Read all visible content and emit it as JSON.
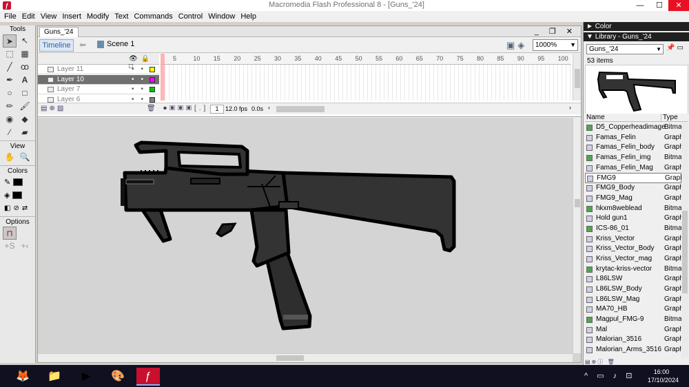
{
  "window": {
    "title": "Macromedia Flash Professional 8 - [Guns_'24]",
    "minimize": "—",
    "maximize": "☐",
    "close": "✕"
  },
  "menu": {
    "items": [
      "File",
      "Edit",
      "View",
      "Insert",
      "Modify",
      "Text",
      "Commands",
      "Control",
      "Window",
      "Help"
    ]
  },
  "tools": {
    "header": "Tools",
    "view_header": "View",
    "colors_header": "Colors",
    "options_header": "Options",
    "stroke_color": "#000000",
    "fill_color": "#000000"
  },
  "document": {
    "tab": "Guns_'24",
    "timeline_button": "Timeline",
    "scene": "Scene 1",
    "zoom": "1000%"
  },
  "timeline": {
    "ticks": [
      "5",
      "10",
      "15",
      "20",
      "25",
      "30",
      "35",
      "40",
      "45",
      "50",
      "55",
      "60",
      "65",
      "70",
      "75",
      "80",
      "85",
      "90",
      "95",
      "100"
    ],
    "layers": [
      {
        "name": "Layer 11",
        "color": "#ffff00",
        "active": false
      },
      {
        "name": "Layer 10",
        "color": "#ff00ff",
        "active": true
      },
      {
        "name": "Layer 7",
        "color": "#00cc00",
        "active": false
      },
      {
        "name": "Layer 6",
        "color": "#808080",
        "active": false
      }
    ],
    "current_frame": "1",
    "fps": "12.0 fps",
    "time": "0.0s"
  },
  "panels": {
    "color_title": "Color",
    "library_title": "Library - Guns_'24"
  },
  "library": {
    "selected_doc": "Guns_'24",
    "count": "53 items",
    "col_name": "Name",
    "col_type": "Type",
    "items": [
      {
        "name": "D5_Copperheadimage",
        "type": "Bitmap",
        "kind": "bitmap"
      },
      {
        "name": "Famas_Felin",
        "type": "Graphic",
        "kind": "graphic"
      },
      {
        "name": "Famas_Felin_body",
        "type": "Graphic",
        "kind": "graphic"
      },
      {
        "name": "Famas_Felin_img",
        "type": "Bitmap",
        "kind": "bitmap"
      },
      {
        "name": "Famas_Felin_Mag",
        "type": "Graphic",
        "kind": "graphic"
      },
      {
        "name": "FMG9",
        "type": "Graphic",
        "kind": "graphic"
      },
      {
        "name": "FMG9_Body",
        "type": "Graphic",
        "kind": "graphic"
      },
      {
        "name": "FMG9_Mag",
        "type": "Graphic",
        "kind": "graphic"
      },
      {
        "name": "hkxm8weblead",
        "type": "Bitmap",
        "kind": "bitmap"
      },
      {
        "name": "Hold gun1",
        "type": "Graphic",
        "kind": "graphic"
      },
      {
        "name": "ICS-86_01",
        "type": "Bitmap",
        "kind": "bitmap"
      },
      {
        "name": "Kriss_Vector",
        "type": "Graphic",
        "kind": "graphic"
      },
      {
        "name": "Kriss_Vector_Body",
        "type": "Graphic",
        "kind": "graphic"
      },
      {
        "name": "Kriss_Vector_mag",
        "type": "Graphic",
        "kind": "graphic"
      },
      {
        "name": "krytac-kriss-vector",
        "type": "Bitmap",
        "kind": "bitmap"
      },
      {
        "name": "L86LSW",
        "type": "Graphic",
        "kind": "graphic"
      },
      {
        "name": "L86LSW_Body",
        "type": "Graphic",
        "kind": "graphic"
      },
      {
        "name": "L86LSW_Mag",
        "type": "Graphic",
        "kind": "graphic"
      },
      {
        "name": "MA70_HB",
        "type": "Graphic",
        "kind": "graphic"
      },
      {
        "name": "Magpul_FMG-9",
        "type": "Bitmap",
        "kind": "bitmap"
      },
      {
        "name": "Mal",
        "type": "Graphic",
        "kind": "graphic"
      },
      {
        "name": "Malorian_3516",
        "type": "Graphic",
        "kind": "graphic"
      },
      {
        "name": "Malorian_Arms_3516",
        "type": "Graphic",
        "kind": "graphic"
      }
    ]
  },
  "taskbar": {
    "apps": [
      "firefox",
      "file-explorer",
      "media-player",
      "paint",
      "flash"
    ],
    "time": "16:00",
    "date": "17/10/2024"
  }
}
